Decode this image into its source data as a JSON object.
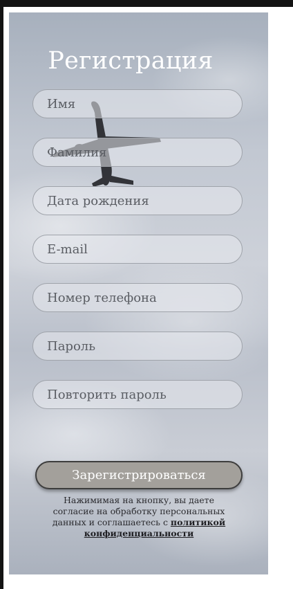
{
  "form": {
    "title": "Регистрация",
    "fields": [
      {
        "name": "first-name",
        "placeholder": "Имя",
        "value": ""
      },
      {
        "name": "last-name",
        "placeholder": "Фамилия",
        "value": ""
      },
      {
        "name": "birth-date",
        "placeholder": "Дата рождения",
        "value": ""
      },
      {
        "name": "email",
        "placeholder": "E-mail",
        "value": ""
      },
      {
        "name": "phone",
        "placeholder": "Номер телефона",
        "value": ""
      },
      {
        "name": "password",
        "placeholder": "Пароль",
        "value": ""
      },
      {
        "name": "password-repeat",
        "placeholder": "Повторить пароль",
        "value": ""
      }
    ],
    "submit_label": "Зарегистрироваться",
    "consent_text": "Нажимимая на кнопку, вы даете согласие на обработку персональных данных и соглашаетесь с ",
    "privacy_link": "политикой конфиденциальности"
  },
  "colors": {
    "frame": "#131313",
    "sky": "#c2c8d2",
    "title": "#ffffff",
    "button": "#a3a09b"
  },
  "icons": {
    "background_image": "airplane-in-cloudy-sky"
  }
}
